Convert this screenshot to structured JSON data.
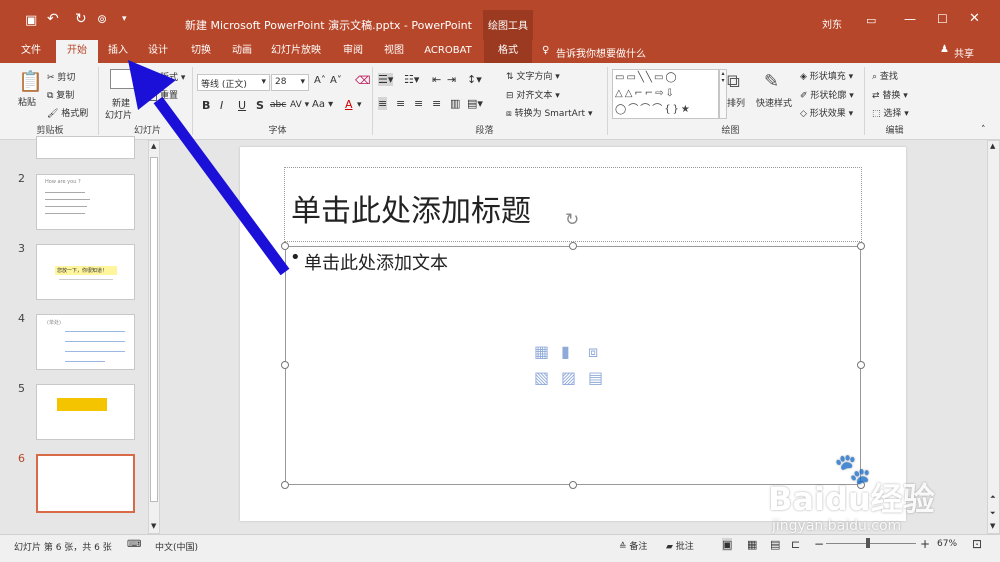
{
  "titlebar": {
    "doc_title": "新建 Microsoft PowerPoint 演示文稿.pptx  -  PowerPoint",
    "context_tools": "绘图工具",
    "user": "刘东"
  },
  "tabs": [
    "文件",
    "开始",
    "插入",
    "设计",
    "切换",
    "动画",
    "幻灯片放映",
    "审阅",
    "视图",
    "ACROBAT",
    "格式"
  ],
  "tell_me": "告诉我你想要做什么",
  "share": "共享",
  "clipboard": {
    "paste": "粘贴",
    "cut": "剪切",
    "copy": "复制",
    "format_painter": "格式刷",
    "label": "剪贴板"
  },
  "slides_group": {
    "new_slide_1": "新建",
    "new_slide_2": "幻灯片",
    "layout": "版式",
    "reset": "重置",
    "label": "幻灯片"
  },
  "font": {
    "name": "等线 (正文)",
    "size": "28",
    "label": "字体",
    "bold": "B",
    "italic": "I",
    "underline": "U",
    "shadow": "S",
    "strike": "abc",
    "spacing": "AV",
    "case": "Aa",
    "color": "A"
  },
  "paragraph": {
    "text_direction": "文字方向",
    "align_text": "对齐文本",
    "smartart": "转换为 SmartArt",
    "label": "段落"
  },
  "drawing": {
    "arrange": "排列",
    "quick_styles": "快速样式",
    "fill": "形状填充",
    "outline": "形状轮廓",
    "effects": "形状效果",
    "label": "绘图"
  },
  "editing": {
    "find": "查找",
    "replace": "替换",
    "select": "选择",
    "label": "编辑"
  },
  "thumbnails": [
    {
      "num": "",
      "text": ""
    },
    {
      "num": "2",
      "text": "How are you ?"
    },
    {
      "num": "3",
      "text": "您放一下，你很知道！"
    },
    {
      "num": "4",
      "text": "(单处)"
    },
    {
      "num": "5",
      "text": ""
    },
    {
      "num": "6",
      "text": ""
    }
  ],
  "slide": {
    "title_placeholder": "单击此处添加标题",
    "body_placeholder": "单击此处添加文本",
    "bullet": "•"
  },
  "statusbar": {
    "slide_info": "幻灯片 第 6 张，共 6 张",
    "language": "中文(中国)",
    "notes": "备注",
    "comments": "批注",
    "zoom": "67%",
    "minus": "−",
    "plus": "+"
  },
  "watermark": {
    "brand": "Baidu经验",
    "url": "jingyan.baidu.com"
  },
  "colors": {
    "accent": "#b7472a",
    "arrow": "#1a10d8",
    "selected_thumb": "#d96a47",
    "slide5_bar": "#f5c400"
  }
}
